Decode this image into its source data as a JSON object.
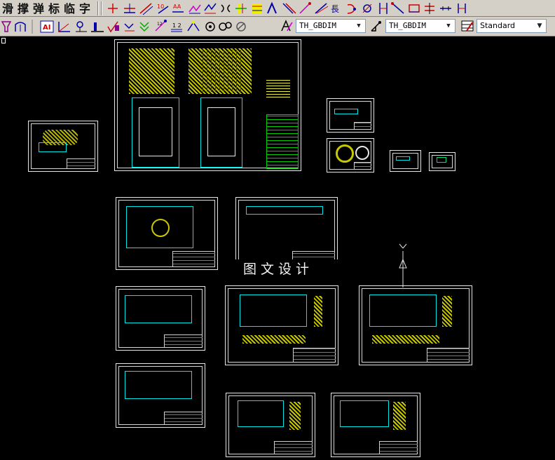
{
  "toolbar1": {
    "chinese_buttons": [
      "滑",
      "撑",
      "弹",
      "标",
      "临",
      "字"
    ]
  },
  "toolbar2": {
    "text_style": {
      "label": "TH_GBDIM"
    },
    "dim_style": {
      "label": "TH_GBDIM"
    },
    "table_style": {
      "label": "Standard"
    }
  },
  "watermark": {
    "text": "图文设计"
  },
  "ucs": {
    "label": "Y"
  },
  "colors": {
    "background": "#000000",
    "toolbar": "#d4d0c8",
    "cad_yellow": "#c8c800",
    "cad_cyan": "#00e5e5",
    "cad_red": "#e00000"
  }
}
